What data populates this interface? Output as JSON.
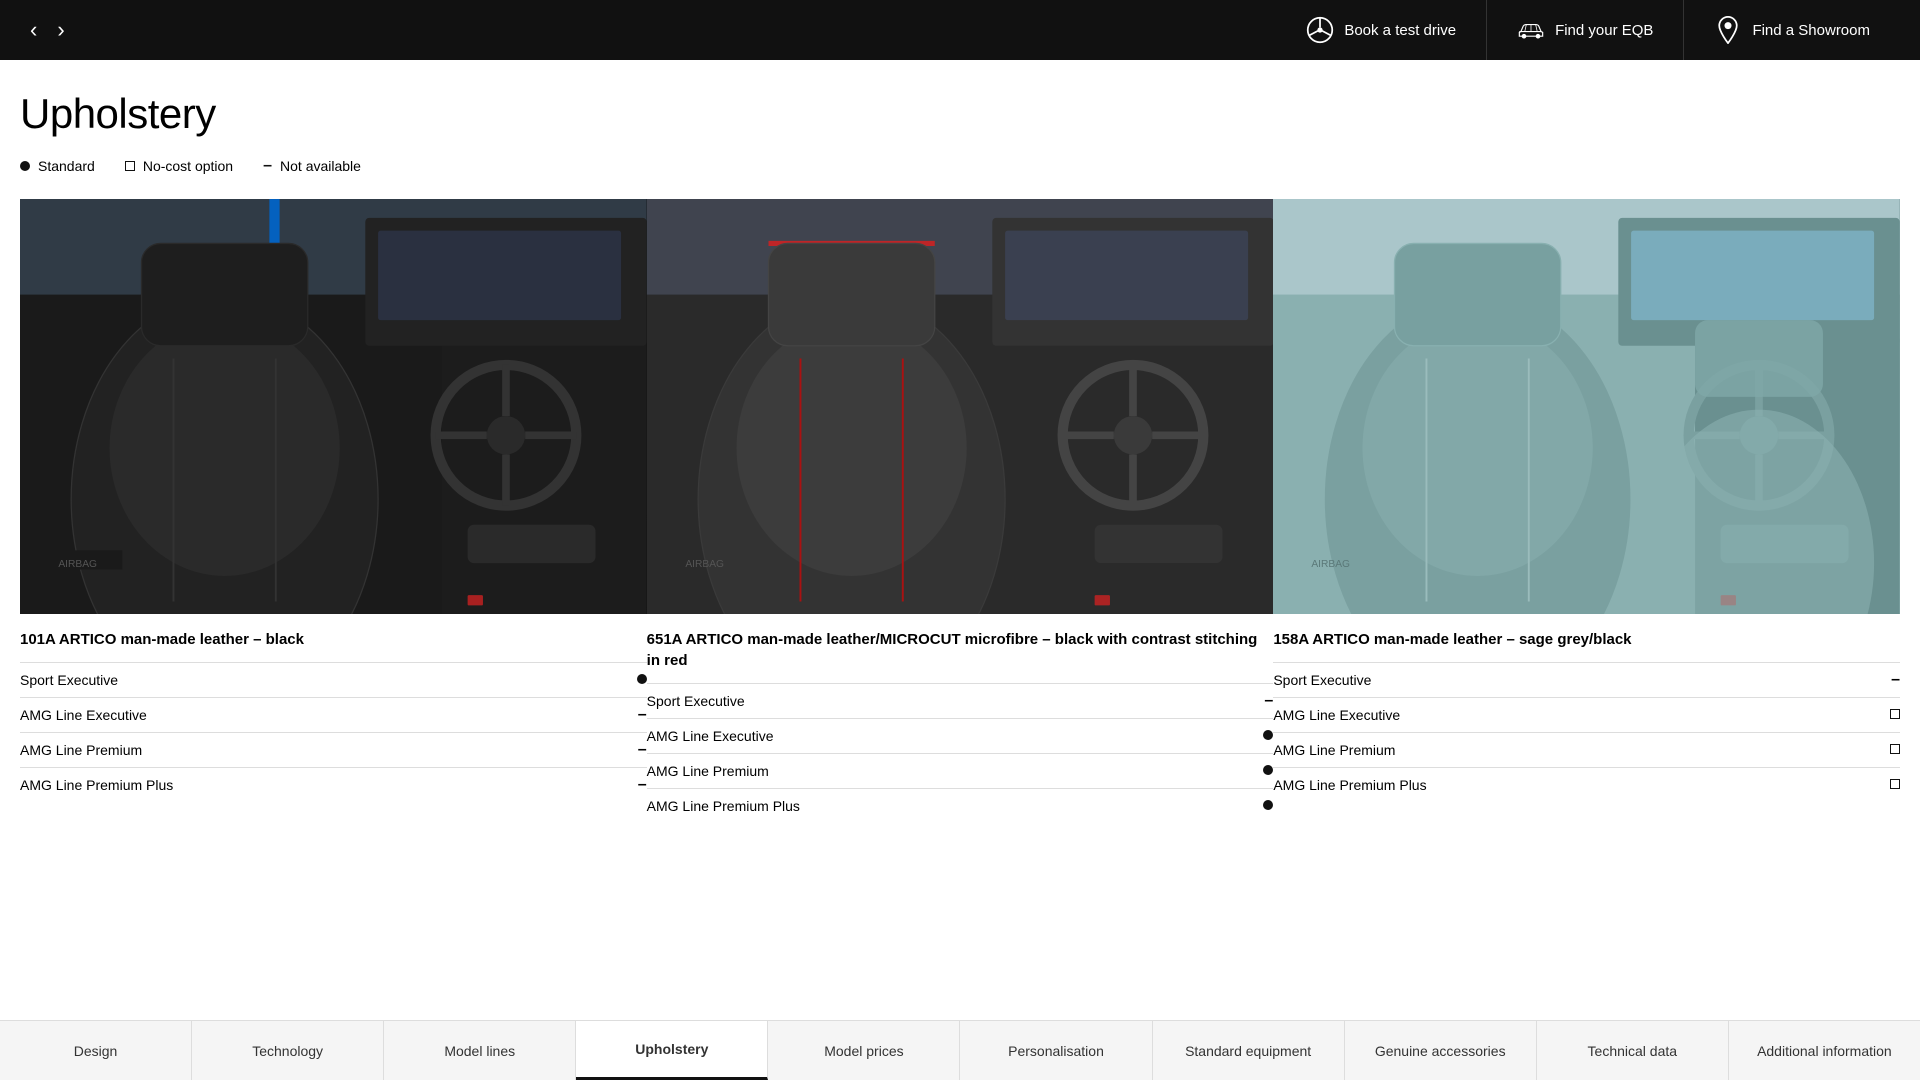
{
  "header": {
    "back_arrow": "‹",
    "forward_arrow": "›",
    "actions": [
      {
        "id": "test-drive",
        "label": "Book a test drive",
        "icon": "steering-wheel"
      },
      {
        "id": "find-eqb",
        "label": "Find your EQB",
        "icon": "car"
      },
      {
        "id": "find-showroom",
        "label": "Find a Showroom",
        "icon": "location-pin"
      }
    ]
  },
  "page": {
    "title": "Upholstery"
  },
  "legend": [
    {
      "id": "standard",
      "symbol": "dot",
      "label": "Standard"
    },
    {
      "id": "no-cost",
      "symbol": "square",
      "label": "No-cost option"
    },
    {
      "id": "not-available",
      "symbol": "dash",
      "label": "Not available"
    }
  ],
  "upholstery_items": [
    {
      "id": "101A",
      "title": "101A  ARTICO man-made leather – black",
      "image_type": "black",
      "rows": [
        {
          "label": "Sport Executive",
          "indicator": "dot"
        },
        {
          "label": "AMG Line Executive",
          "indicator": "dash"
        },
        {
          "label": "AMG Line Premium",
          "indicator": "dash"
        },
        {
          "label": "AMG Line Premium Plus",
          "indicator": "dash"
        }
      ]
    },
    {
      "id": "651A",
      "title": "651A  ARTICO man-made leather/MICROCUT microfibre – black with contrast stitching in red",
      "image_type": "grey",
      "rows": [
        {
          "label": "Sport Executive",
          "indicator": "dash"
        },
        {
          "label": "AMG Line Executive",
          "indicator": "dot"
        },
        {
          "label": "AMG Line Premium",
          "indicator": "dot"
        },
        {
          "label": "AMG Line Premium Plus",
          "indicator": "dot"
        }
      ]
    },
    {
      "id": "158A",
      "title": "158A  ARTICO man-made leather – sage grey/black",
      "image_type": "sage",
      "rows": [
        {
          "label": "Sport Executive",
          "indicator": "dash"
        },
        {
          "label": "AMG Line Executive",
          "indicator": "square"
        },
        {
          "label": "AMG Line Premium",
          "indicator": "square"
        },
        {
          "label": "AMG Line Premium Plus",
          "indicator": "square"
        }
      ]
    }
  ],
  "bottom_nav": [
    {
      "id": "design",
      "label": "Design",
      "active": false
    },
    {
      "id": "technology",
      "label": "Technology",
      "active": false
    },
    {
      "id": "model-lines",
      "label": "Model lines",
      "active": false
    },
    {
      "id": "upholstery",
      "label": "Upholstery",
      "active": true
    },
    {
      "id": "model-prices",
      "label": "Model prices",
      "active": false
    },
    {
      "id": "personalisation",
      "label": "Personalisation",
      "active": false
    },
    {
      "id": "standard-equipment",
      "label": "Standard equipment",
      "active": false
    },
    {
      "id": "genuine-accessories",
      "label": "Genuine accessories",
      "active": false
    },
    {
      "id": "technical-data",
      "label": "Technical data",
      "active": false
    },
    {
      "id": "additional-info",
      "label": "Additional information",
      "active": false
    }
  ]
}
